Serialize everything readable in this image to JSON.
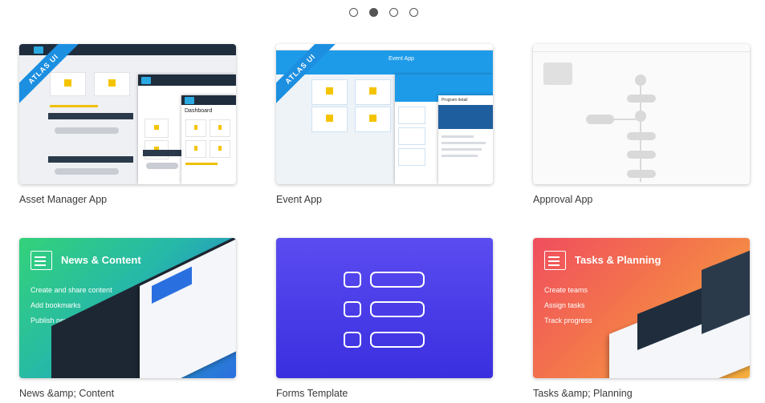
{
  "carousel": {
    "pages": 4,
    "active_index": 1
  },
  "cards": [
    {
      "caption": "Asset Manager App",
      "ribbon": "ATLAS UI",
      "screen_title": "Dashboard"
    },
    {
      "caption": "Event App",
      "ribbon": "ATLAS UI",
      "screen_title": "Event App",
      "sub_title": "Program detail"
    },
    {
      "caption": "Approval App"
    },
    {
      "caption": "News &amp; Content",
      "banner_title": "News & Content",
      "items": [
        "Create and share content",
        "Add bookmarks",
        "Publish news"
      ],
      "colors": [
        "#2ecc71",
        "#2a7de1"
      ]
    },
    {
      "caption": "Forms Template",
      "colors": [
        "#5b4cf0",
        "#3a2fe0"
      ]
    },
    {
      "caption": "Tasks &amp; Planning",
      "banner_title": "Tasks & Planning",
      "items": [
        "Create teams",
        "Assign tasks",
        "Track progress"
      ],
      "colors": [
        "#f05a5a",
        "#f7a23c"
      ]
    }
  ]
}
